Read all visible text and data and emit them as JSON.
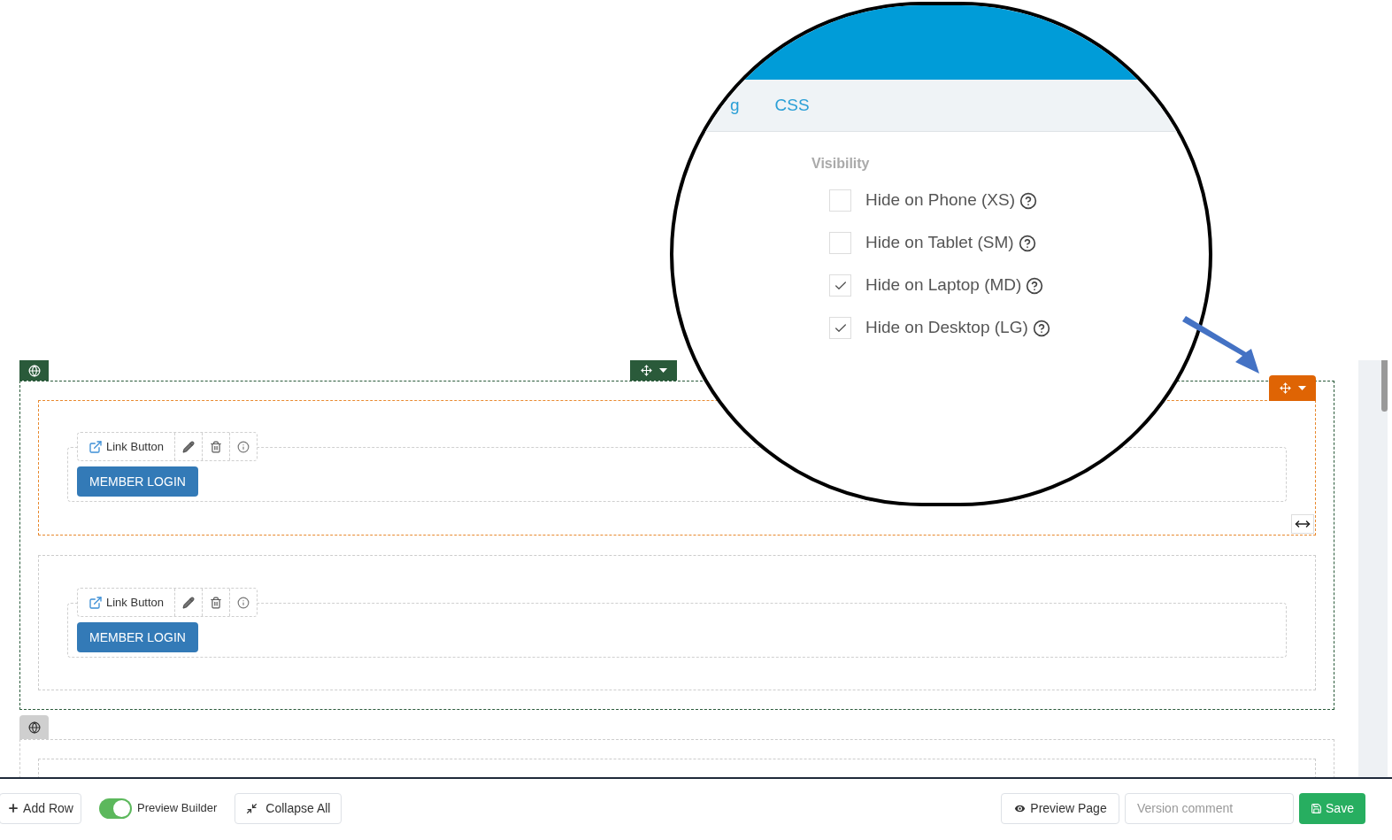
{
  "builder": {
    "sections": [
      {
        "highlighted": true,
        "columns": [
          {
            "highlighted": true,
            "modules": [
              {
                "type_label": "Link Button",
                "button_label": "MEMBER LOGIN"
              }
            ]
          },
          {
            "highlighted": false,
            "modules": [
              {
                "type_label": "Link Button",
                "button_label": "MEMBER LOGIN"
              }
            ]
          }
        ]
      },
      {
        "highlighted": false
      }
    ]
  },
  "callout": {
    "tabs": [
      {
        "label": "g"
      },
      {
        "label": "CSS"
      }
    ],
    "group_label": "Visibility",
    "options": [
      {
        "label": "Hide on Phone (XS)",
        "checked": false
      },
      {
        "label": "Hide on Tablet (SM)",
        "checked": false
      },
      {
        "label": "Hide on Laptop (MD)",
        "checked": true
      },
      {
        "label": "Hide on Desktop (LG)",
        "checked": true
      }
    ]
  },
  "toolbar": {
    "add_row": "Add Row",
    "preview_builder": {
      "label": "Preview Builder",
      "on": true
    },
    "collapse_all": "Collapse All",
    "preview_page": "Preview Page",
    "version_comment": {
      "placeholder": "Version comment"
    },
    "save": "Save"
  }
}
